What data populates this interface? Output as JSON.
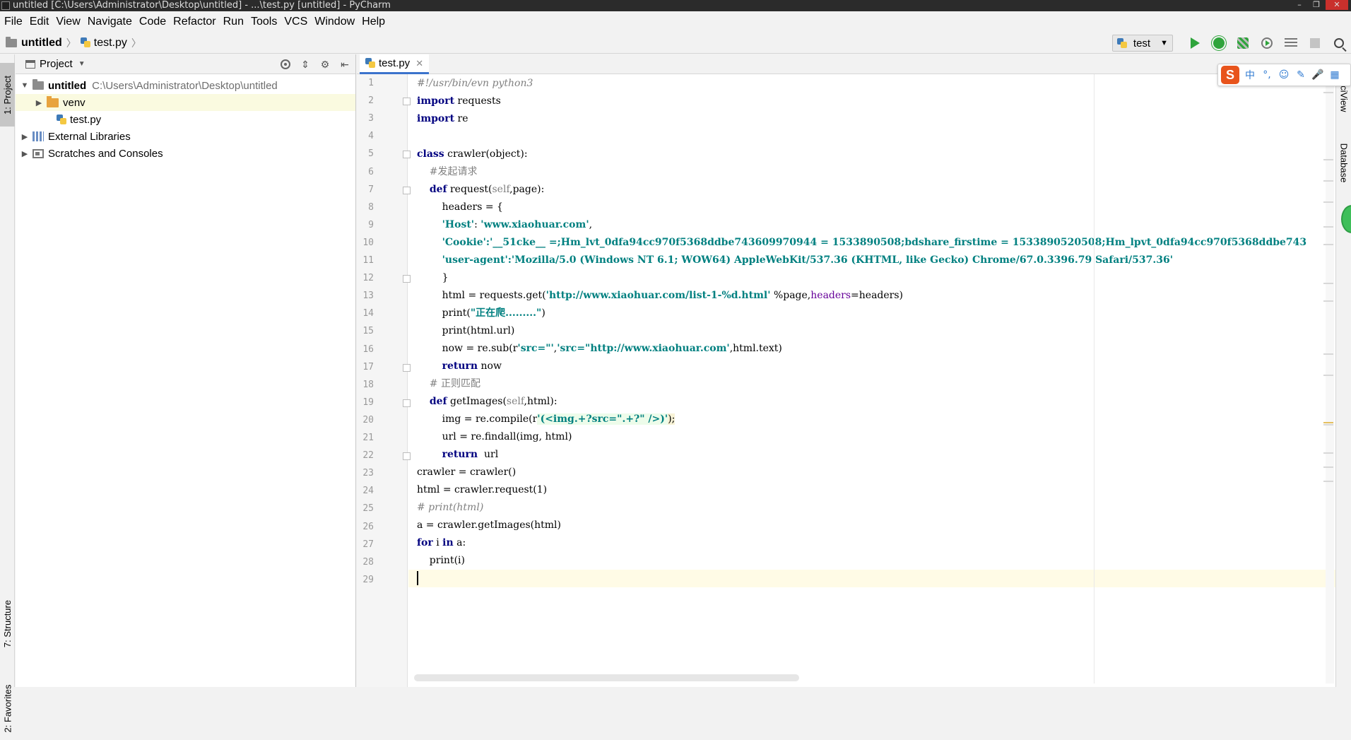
{
  "window": {
    "title": "untitled [C:\\Users\\Administrator\\Desktop\\untitled] - ...\\test.py [untitled] - PyCharm",
    "controls": [
      "–",
      "❐",
      "✕"
    ]
  },
  "menu": [
    "File",
    "Edit",
    "View",
    "Navigate",
    "Code",
    "Refactor",
    "Run",
    "Tools",
    "VCS",
    "Window",
    "Help"
  ],
  "breadcrumb": {
    "project": "untitled",
    "file": "test.py"
  },
  "run_config": {
    "name": "test"
  },
  "left_strip": {
    "project_tab": "1: Project",
    "structure_tab": "7: Structure",
    "favorites_tab": "2: Favorites"
  },
  "project_panel": {
    "title": "Project",
    "tree": [
      {
        "label": "untitled",
        "path": "C:\\Users\\Administrator\\Desktop\\untitled",
        "expanded": true
      },
      {
        "label": "venv"
      },
      {
        "label": "test.py"
      },
      {
        "label": "External Libraries"
      },
      {
        "label": "Scratches and Consoles"
      }
    ]
  },
  "editor": {
    "tab": "test.py",
    "line_numbers": [
      "1",
      "2",
      "3",
      "4",
      "5",
      "6",
      "7",
      "8",
      "9",
      "10",
      "11",
      "12",
      "13",
      "14",
      "15",
      "16",
      "17",
      "18",
      "19",
      "20",
      "21",
      "22",
      "23",
      "24",
      "25",
      "26",
      "27",
      "28",
      "29"
    ],
    "lines": {
      "l1": "#!/usr/bin/evn python3",
      "l2_kw": "import",
      "l2_rest": " requests",
      "l3_kw": "import",
      "l3_rest": " re",
      "l5_kw": "class",
      "l5_rest": " crawler(object):",
      "l6": "    #发起请求",
      "l7_pre": "    ",
      "l7_kw": "def",
      "l7_name": " request(",
      "l7_self": "self",
      "l7_rest": ",page):",
      "l8": "        headers = {",
      "l9_pre": "        ",
      "l9_s1": "'Host'",
      "l9_mid": ": ",
      "l9_s2": "'www.xiaohuar.com'",
      "l9_end": ",",
      "l10_pre": "        ",
      "l10_s": "'Cookie':'__51cke__ =;Hm_lvt_0dfa94cc970f5368ddbe743609970944 = 1533890508;bdshare_firstime = 1533890520508;Hm_lpvt_0dfa94cc970f5368ddbe743",
      "l11_pre": "        ",
      "l11_s": "'user-agent':'Mozilla/5.0 (Windows NT 6.1; WOW64) AppleWebKit/537.36 (KHTML, like Gecko) Chrome/67.0.3396.79 Safari/537.36'",
      "l12": "        }",
      "l13_pre": "        html = requests.get(",
      "l13_s": "'http://www.xiaohuar.com/list-1-%d.html'",
      "l13_mid": " %page,",
      "l13_param": "headers",
      "l13_end": "=headers)",
      "l14_pre": "        print(",
      "l14_s": "\"正在爬.........\"",
      "l14_end": ")",
      "l15": "        print(html.url)",
      "l16_pre": "        now = re.sub(r",
      "l16_s1": "'src=\"'",
      "l16_mid": ",",
      "l16_s2": "'src=\"http://www.xiaohuar.com'",
      "l16_end": ",html.text)",
      "l17_pre": "        ",
      "l17_kw": "return",
      "l17_rest": " now",
      "l18": "    # 正则匹配",
      "l19_pre": "    ",
      "l19_kw": "def",
      "l19_name": " getImages(",
      "l19_self": "self",
      "l19_rest": ",html):",
      "l20_pre": "        img = re.compile(r",
      "l20_s": "'(<img.+?src=\".+?\" />)'",
      "l20_end": ");",
      "l21": "        url = re.findall(img, html)",
      "l22_pre": "        ",
      "l22_kw": "return",
      "l22_rest": "  url",
      "l23": "crawler = crawler()",
      "l24": "html = crawler.request(1)",
      "l25": "# print(html)",
      "l26": "a = crawler.getImages(html)",
      "l27_kw1": "for",
      "l27_mid": " i ",
      "l27_kw2": "in",
      "l27_rest": " a:",
      "l28": "    print(i)"
    }
  },
  "right_strip": {
    "sciview_tab": "SciView",
    "database_tab": "Database"
  },
  "ime": {
    "logo": "S",
    "items": [
      "中",
      "°,",
      "☺",
      "✎",
      "🎤",
      "▦"
    ]
  },
  "colors": {
    "keyword": "#000080",
    "string": "#008080",
    "comment": "#808080",
    "accent": "#3b73cc",
    "run": "#2fa43c"
  }
}
